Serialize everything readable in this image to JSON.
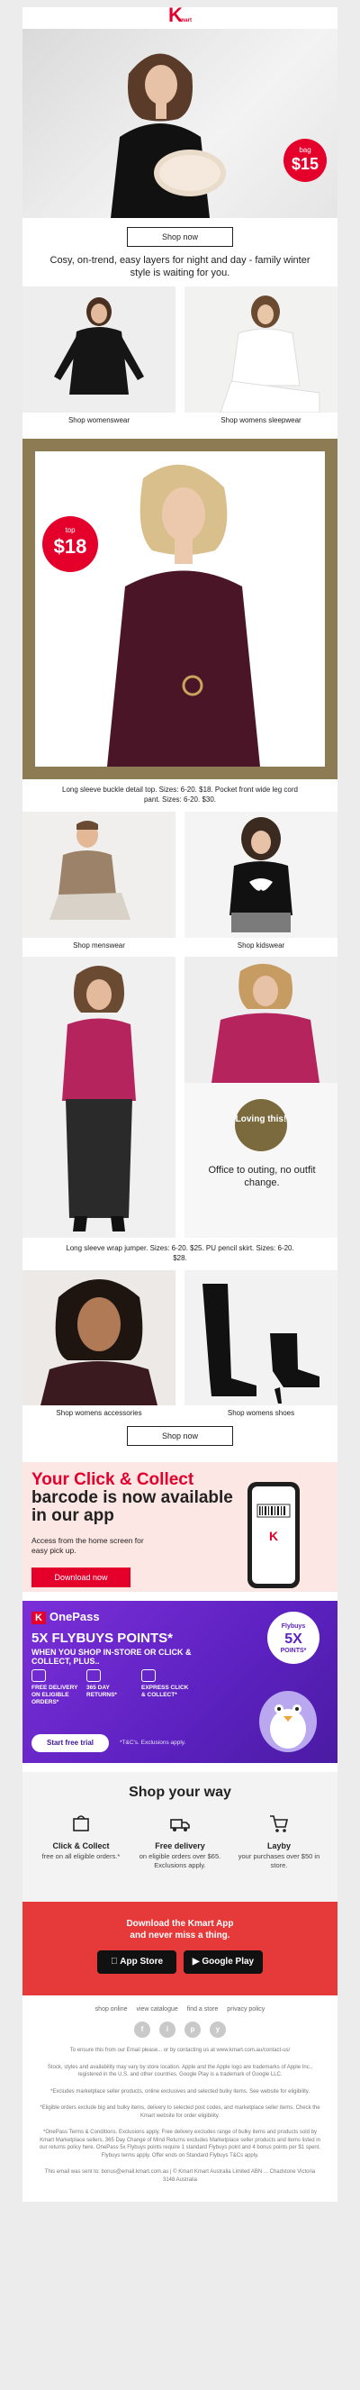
{
  "header": {
    "brand": "K",
    "brand_small": "mart"
  },
  "hero": {
    "badge_label": "bag",
    "badge_price": "$15"
  },
  "cta": {
    "shop_now": "Shop now"
  },
  "tagline": "Cosy, on-trend, easy layers for night and day - family winter style is waiting for you.",
  "row1": [
    {
      "caption": "Shop womenswear"
    },
    {
      "caption": "Shop womens sleepwear"
    }
  ],
  "feature1": {
    "badge_label": "top",
    "badge_price": "$18",
    "caption": "Long sleeve buckle detail top. Sizes: 6-20. $18. Pocket front wide leg cord pant. Sizes: 6-20. $30."
  },
  "row2": [
    {
      "caption": "Shop menswear"
    },
    {
      "caption": "Shop kidswear"
    }
  ],
  "feature2": {
    "circle_text": "Loving this!",
    "overlay_text": "Office to outing, no outfit change.",
    "caption": "Long sleeve wrap jumper. Sizes: 6-20. $25. PU pencil skirt. Sizes: 6-20. $28."
  },
  "row3": [
    {
      "caption": "Shop womens accessories"
    },
    {
      "caption": "Shop womens shoes"
    }
  ],
  "click_collect": {
    "title_red": "Your Click & Collect",
    "title_rest": "barcode is now available in our app",
    "body": "Access from the home screen for easy pick up.",
    "button": "Download now"
  },
  "onepass": {
    "logo": "OnePass",
    "title": "5X FLYBUYS POINTS*",
    "subtitle": "WHEN YOU SHOP IN-STORE OR CLICK & COLLECT, PLUS..",
    "features": [
      "FREE DELIVERY ON ELIGIBLE ORDERS*",
      "365 DAY RETURNS*",
      "EXPRESS CLICK & COLLECT*"
    ],
    "button": "Start free trial",
    "tc": "*T&C's. Exclusions apply.",
    "badge_top": "Flybuys",
    "badge_main": "5X",
    "badge_bottom": "POINTS*"
  },
  "shop_your_way": {
    "title": "Shop your way",
    "items": [
      {
        "title": "Click & Collect",
        "desc": "free on all eligible orders.*"
      },
      {
        "title": "Free delivery",
        "desc": "on eligible orders over $65. Exclusions apply."
      },
      {
        "title": "Layby",
        "desc": "your purchases over $50 in store."
      }
    ]
  },
  "app": {
    "line1": "Download the Kmart App",
    "line2": "and never miss a thing.",
    "app_store": "App Store",
    "google_play": "Google Play"
  },
  "footer": {
    "links": [
      "shop online",
      "view catalogue",
      "find a store",
      "privacy policy"
    ],
    "socials": [
      "f",
      "i",
      "p",
      "y"
    ],
    "fine1": "To ensure this from our Email please... or by contacting us at www.kmart.com.au/contact-us/",
    "fine2": "Stock, styles and availability may vary by store location. Apple and the Apple logo are trademarks of Apple Inc., registered in the U.S. and other countries. Google Play is a trademark of Google LLC.",
    "fine3": "*Excludes marketplace seller products, online exclusives and selected bulky items. See website for eligibility.",
    "fine4": "*Eligible orders exclude big and bulky items, delivery to selected post codes, and marketplace seller items. Check the Kmart website for order eligibility.",
    "fine5": "*OnePass Terms & Conditions. Exclusions apply. Free delivery excludes range of bulky items and products sold by Kmart Marketplace sellers. 365 Day Change of Mind Returns excludes Marketplace seller products and items listed in our returns policy here. OnePass 5x Flybuys points require 1 standard Flybuys point and 4 bonus points per $1 spent. Flybuys terms apply. Offer ends on Standard Flybuys T&Cs apply.",
    "address": "This email was sent to: bonus@email.kmart.com.au | © Kmart Kmart Australia Limited ABN ... Chadstone Victoria 3148 Australia"
  }
}
